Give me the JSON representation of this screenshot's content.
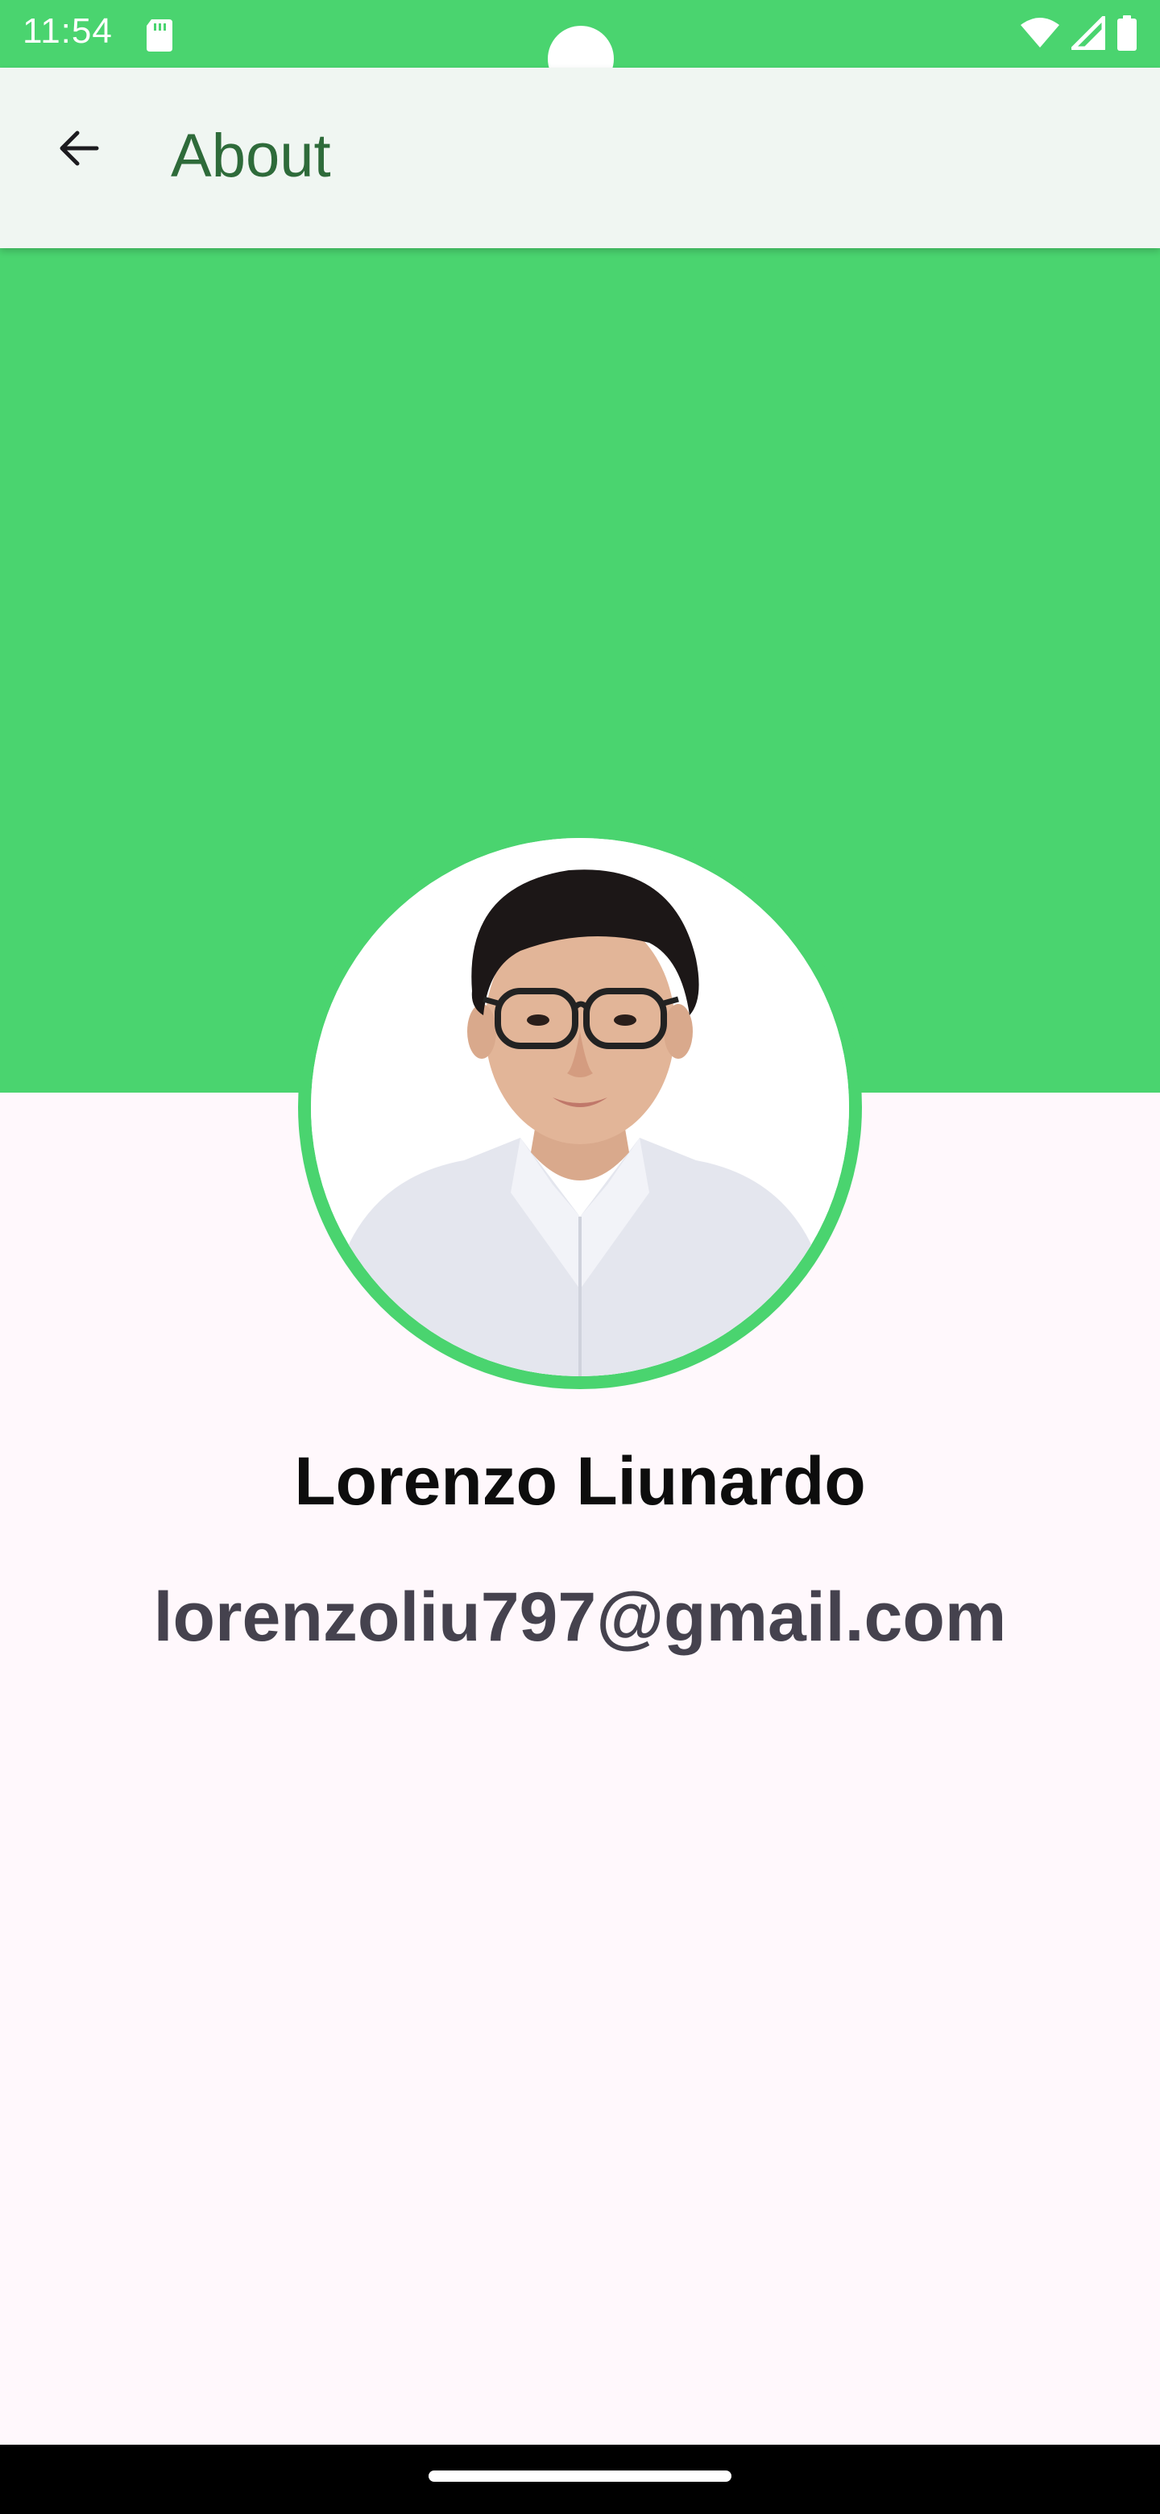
{
  "status_bar": {
    "time": "11:54",
    "icons": [
      "sd-card-icon",
      "wifi-icon",
      "cell-signal-icon",
      "battery-icon"
    ],
    "background": "#4AD46F"
  },
  "top_bar": {
    "title": "About",
    "back_icon": "arrow-left-icon",
    "background": "#F0F6F2",
    "title_color": "#2E6B3A"
  },
  "header_banner": {
    "color": "#4AD46F"
  },
  "profile": {
    "avatar_icon": "profile-photo",
    "name": "Lorenzo Liunardo",
    "email": "lorenzoliu797@gmail.com"
  },
  "colors": {
    "accent": "#4AD46F",
    "background": "#FFF8FC",
    "name_text": "#0D0D0D",
    "email_text": "#45424E"
  }
}
